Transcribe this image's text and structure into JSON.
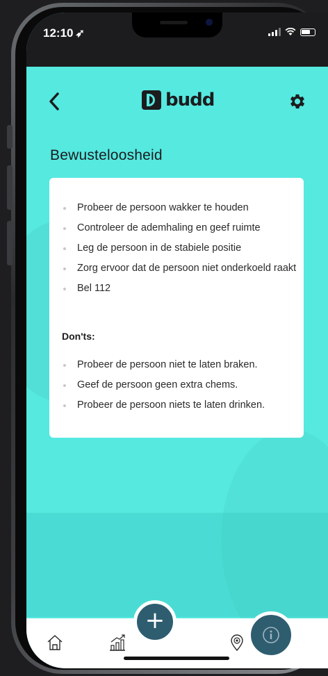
{
  "status_bar": {
    "time": "12:10",
    "location_glyph": "➶"
  },
  "header": {
    "back_glyph": "‹",
    "logo_text": "budd"
  },
  "page": {
    "title": "Bewusteloosheid",
    "dos": [
      "Probeer de persoon wakker te houden",
      "Controleer de ademhaling en geef ruimte",
      "Leg de persoon in de stabiele positie",
      "Zorg ervoor dat de persoon niet onderkoeld raakt",
      "Bel 112"
    ],
    "donts_heading": "Don'ts:",
    "donts": [
      "Probeer de persoon niet te laten braken.",
      "Geef de persoon geen extra chems.",
      "Probeer de persoon niets te laten drinken."
    ]
  },
  "nav": {
    "items": [
      "home-icon",
      "chart-icon",
      "location-pin-icon"
    ],
    "add_glyph": "+",
    "accent": "#2f5d70",
    "background": "#55e9e0"
  }
}
